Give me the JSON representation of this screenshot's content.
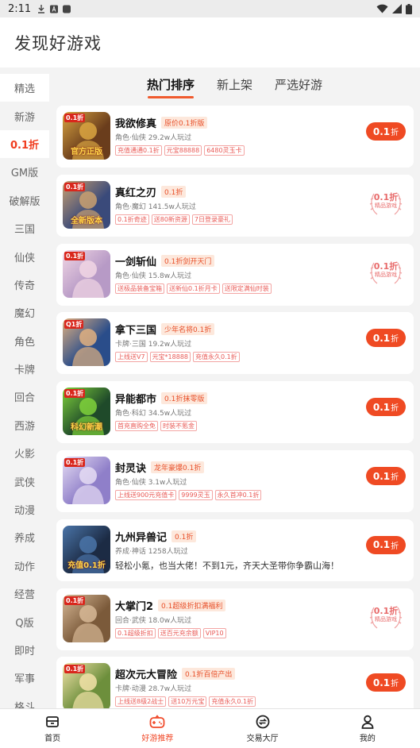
{
  "status_bar": {
    "time": "2:11"
  },
  "header": {
    "title": "发现好游戏"
  },
  "tabs": [
    {
      "label": "热门排序",
      "active": true
    },
    {
      "label": "新上架",
      "active": false
    },
    {
      "label": "严选好游",
      "active": false
    }
  ],
  "sidebar": {
    "items": [
      {
        "label": "精选"
      },
      {
        "label": "新游"
      },
      {
        "label": "0.1折",
        "active": true
      },
      {
        "label": "GM版"
      },
      {
        "label": "破解版"
      },
      {
        "label": "三国"
      },
      {
        "label": "仙侠"
      },
      {
        "label": "传奇"
      },
      {
        "label": "魔幻"
      },
      {
        "label": "角色"
      },
      {
        "label": "卡牌"
      },
      {
        "label": "回合"
      },
      {
        "label": "西游"
      },
      {
        "label": "火影"
      },
      {
        "label": "武侠"
      },
      {
        "label": "动漫"
      },
      {
        "label": "养成"
      },
      {
        "label": "动作"
      },
      {
        "label": "经营"
      },
      {
        "label": "Q版"
      },
      {
        "label": "即时"
      },
      {
        "label": "军事"
      },
      {
        "label": "格斗"
      }
    ]
  },
  "games": [
    {
      "name": "我欲修真",
      "tag": "原价0.1折版",
      "meta": "角色·仙侠  29.2w人玩过",
      "features": [
        "充值通通0.1折",
        "元宝88888",
        "6480灵玉卡"
      ],
      "action": "button",
      "action_value": "0.1",
      "action_unit": "折",
      "thumb_badge": "0.1折",
      "thumb_ribbon": "官方正版",
      "thumb_colors": [
        "#6a3d1c",
        "#d9a441"
      ]
    },
    {
      "name": "真红之刃",
      "tag": "0.1折",
      "meta": "角色·魔幻  141.5w人玩过",
      "features": [
        "0.1折奇迹",
        "送80新资源",
        "7日登录豪礼"
      ],
      "action": "seal",
      "action_value": "0.1折",
      "seal_label": "精品游戏",
      "thumb_badge": "0.1折",
      "thumb_ribbon": "全新版本",
      "thumb_colors": [
        "#3a4a7a",
        "#c9a070"
      ]
    },
    {
      "name": "一剑斩仙",
      "tag": "0.1折剑开天门",
      "meta": "角色·仙侠  15.8w人玩过",
      "features": [
        "送极品装备宝箱",
        "送新仙0.1折月卡",
        "送限定满仙时装"
      ],
      "action": "seal",
      "action_value": "0.1折",
      "seal_label": "精品游戏",
      "thumb_badge": "0.1折",
      "thumb_ribbon": "",
      "thumb_colors": [
        "#b79ac6",
        "#f1d6e4"
      ]
    },
    {
      "name": "拿下三国",
      "tag": "少年名将0.1折",
      "meta": "卡牌·三国  19.2w人玩过",
      "features": [
        "上线送V7",
        "元宝*18888",
        "充值永久0.1折"
      ],
      "action": "button",
      "action_value": "0.1",
      "action_unit": "折",
      "thumb_badge": "Q1折",
      "thumb_ribbon": "",
      "thumb_colors": [
        "#2a4d8a",
        "#e0b080"
      ]
    },
    {
      "name": "异能都市",
      "tag": "0.1折抹零版",
      "meta": "角色·科幻  34.5w人玩过",
      "features": [
        "首充直购全免",
        "时装不氪金"
      ],
      "action": "button",
      "action_value": "0.1",
      "action_unit": "折",
      "thumb_badge": "0.1折",
      "thumb_ribbon": "科幻新潮",
      "thumb_colors": [
        "#1f4a2a",
        "#7fd13b"
      ]
    },
    {
      "name": "封灵诀",
      "tag": "龙年豪爆0.1折",
      "meta": "角色·仙侠  3.1w人玩过",
      "features": [
        "上线送900元充值卡",
        "9999灵玉",
        "永久首冲0.1折"
      ],
      "action": "button",
      "action_value": "0.1",
      "action_unit": "折",
      "thumb_badge": "0.1折",
      "thumb_ribbon": "",
      "thumb_colors": [
        "#8f7fc9",
        "#e5dcf3"
      ]
    },
    {
      "name": "九州异兽记",
      "tag": "0.1折",
      "meta": "养成·神话  1258人玩过",
      "slogan": "轻松小氪，也当大佬！不到1元，齐天大圣带你争霸山海！",
      "action": "button",
      "action_value": "0.1",
      "action_unit": "折",
      "thumb_badge": "",
      "thumb_ribbon": "充值0.1折",
      "thumb_colors": [
        "#1c2b44",
        "#4a74a8"
      ]
    },
    {
      "name": "大掌门2",
      "tag": "0.1超级折扣满福利",
      "meta": "回合·武侠  18.0w人玩过",
      "features": [
        "0.1超级折扣",
        "送百元充余额",
        "VIP10"
      ],
      "action": "seal",
      "action_value": "0.1折",
      "seal_label": "精品游戏",
      "thumb_badge": "0.1折",
      "thumb_ribbon": "",
      "thumb_colors": [
        "#7b5a3a",
        "#d7b896"
      ]
    },
    {
      "name": "超次元大冒险",
      "tag": "0.1折百倍产出",
      "meta": "卡牌·动漫  28.7w人玩过",
      "features": [
        "上线送8级2战士",
        "送10万元宝",
        "充值永久0.1折"
      ],
      "action": "button",
      "action_value": "0.1",
      "action_unit": "折",
      "thumb_badge": "0.1折",
      "thumb_ribbon": "",
      "thumb_colors": [
        "#6d8f3c",
        "#f2e2a8"
      ]
    }
  ],
  "bottom_nav": [
    {
      "label": "首页",
      "icon": "home-icon",
      "active": false
    },
    {
      "label": "好游推荐",
      "icon": "gamepad-icon",
      "active": true
    },
    {
      "label": "交易大厅",
      "icon": "exchange-icon",
      "active": false
    },
    {
      "label": "我的",
      "icon": "user-icon",
      "active": false
    }
  ],
  "colors": {
    "accent": "#ef4a23",
    "tag_bg": "#fde8dc",
    "feature_border": "#f3a5a3"
  }
}
